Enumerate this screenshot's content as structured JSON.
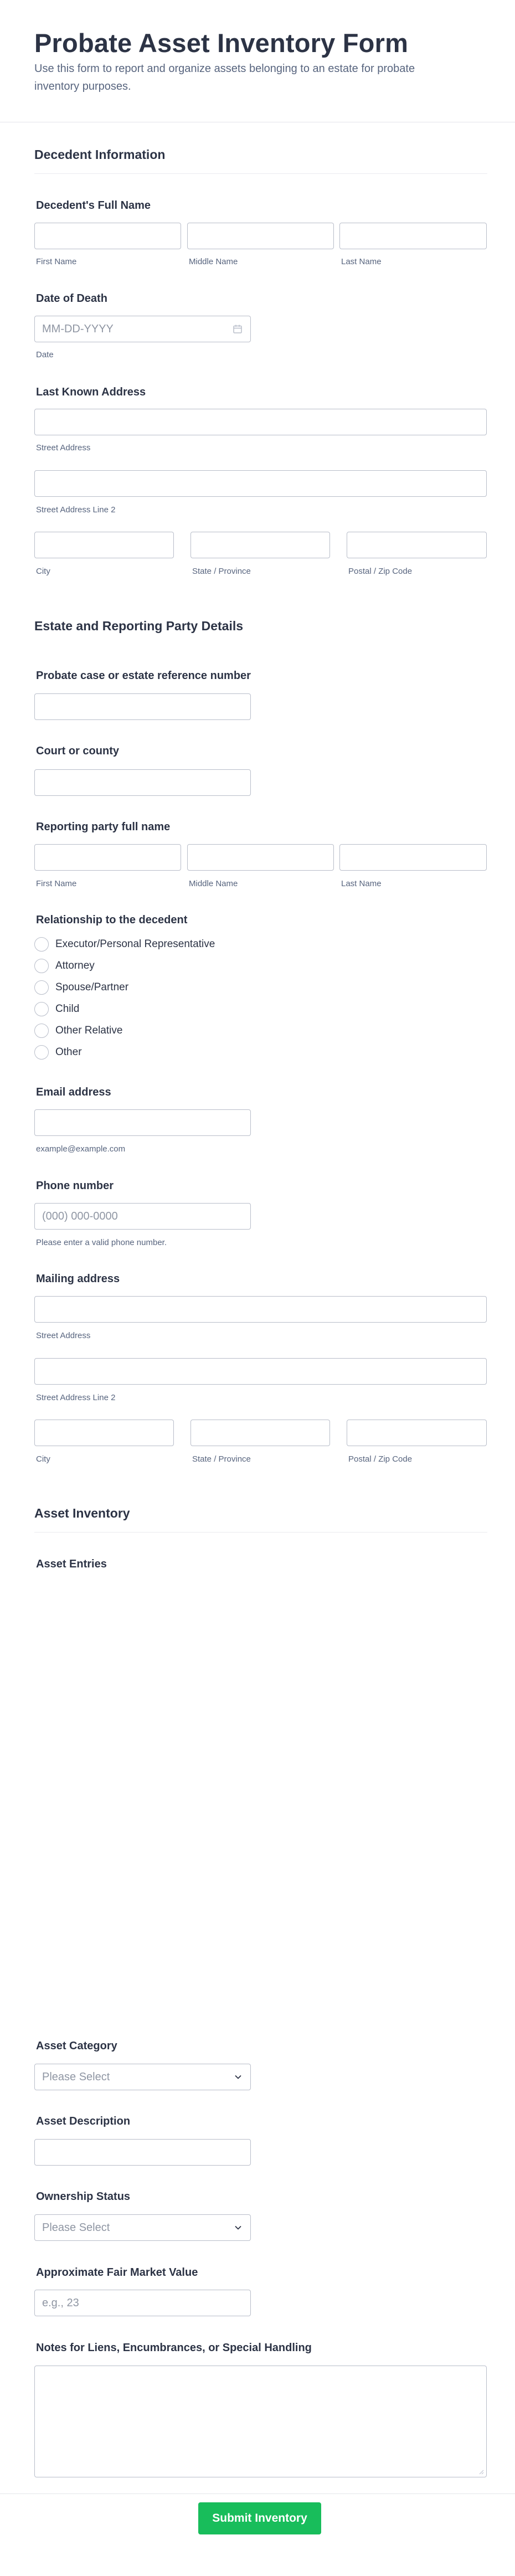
{
  "header": {
    "title": "Probate Asset Inventory Form",
    "subtitle": "Use this form to report and organize assets belonging to an estate for probate inventory purposes."
  },
  "decedent": {
    "section_title": "Decedent Information",
    "full_name_label": "Decedent's Full Name",
    "first_name_sub": "First Name",
    "middle_name_sub": "Middle Name",
    "last_name_sub": "Last Name",
    "dod_label": "Date of Death",
    "dod_placeholder": "MM-DD-YYYY",
    "dod_sub": "Date",
    "address_label": "Last Known Address",
    "street_sub": "Street Address",
    "street2_sub": "Street Address Line 2",
    "city_sub": "City",
    "state_sub": "State / Province",
    "zip_sub": "Postal / Zip Code"
  },
  "estate": {
    "section_title": "Estate and Reporting Party Details",
    "case_label": "Probate case or estate reference number",
    "court_label": "Court or county",
    "party_label": "Reporting party full name",
    "first_name_sub": "First Name",
    "middle_name_sub": "Middle Name",
    "last_name_sub": "Last Name",
    "relationship_label": "Relationship to the decedent",
    "relationship_options": [
      "Executor/Personal Representative",
      "Attorney",
      "Spouse/Partner",
      "Child",
      "Other Relative",
      "Other"
    ],
    "email_label": "Email address",
    "email_sub": "example@example.com",
    "phone_label": "Phone number",
    "phone_placeholder": "(000) 000-0000",
    "phone_sub": "Please enter a valid phone number.",
    "mailing_label": "Mailing address",
    "street_sub": "Street Address",
    "street2_sub": "Street Address Line 2",
    "city_sub": "City",
    "state_sub": "State / Province",
    "zip_sub": "Postal / Zip Code"
  },
  "assets": {
    "section_title": "Asset Inventory",
    "entries_label": "Asset Entries",
    "category_label": "Asset Category",
    "category_selected": "Please Select",
    "description_label": "Asset Description",
    "ownership_label": "Ownership Status",
    "ownership_selected": "Please Select",
    "value_label": "Approximate Fair Market Value",
    "value_placeholder": "e.g., 23",
    "notes_label": "Notes for Liens, Encumbrances, or Special Handling"
  },
  "footer": {
    "submit_label": "Submit Inventory"
  },
  "icons": {
    "calendar": "calendar-icon",
    "dropdown": "chevron-down-icon"
  },
  "colors": {
    "submit": "#18bd5b",
    "text": "#2c3345",
    "muted": "#57647e",
    "border": "#b8bdc9"
  }
}
